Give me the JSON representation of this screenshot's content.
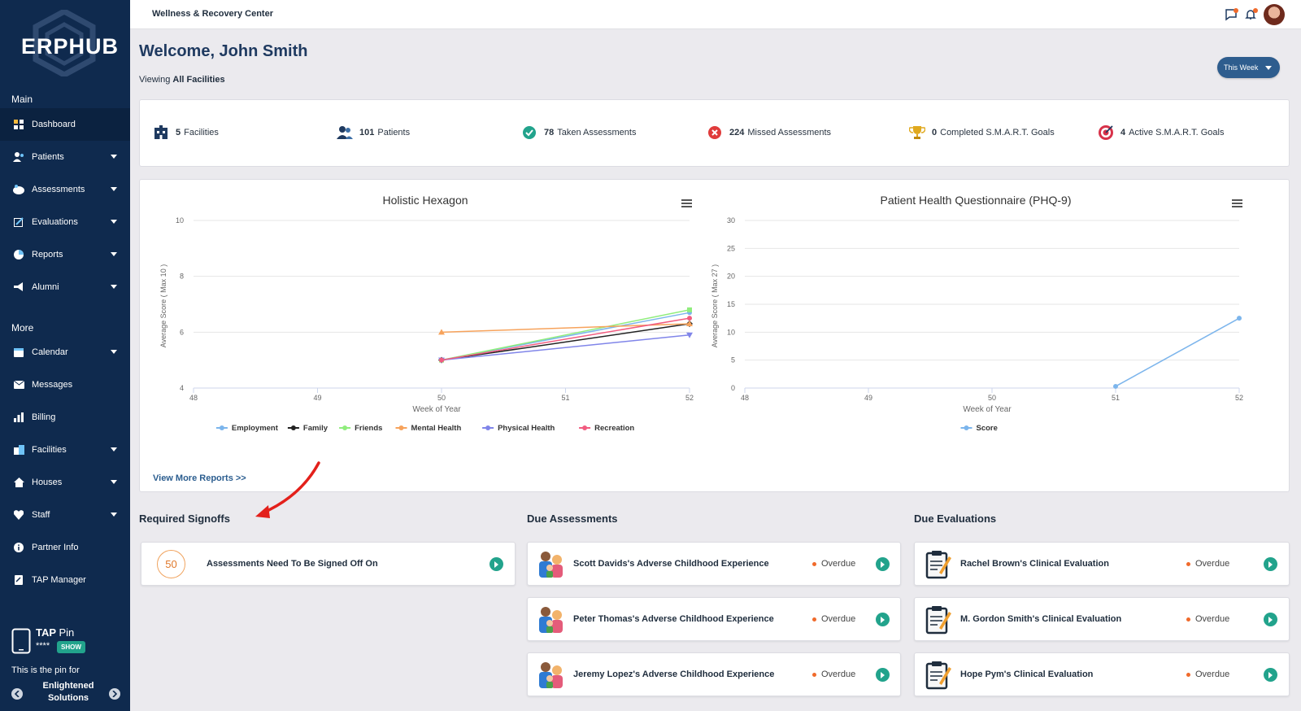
{
  "app": {
    "logo": "ERPHUB",
    "center_name": "Wellness & Recovery Center"
  },
  "sidebar": {
    "main_label": "Main",
    "more_label": "More",
    "items": [
      {
        "label": "Dashboard",
        "icon": "dashboard-icon",
        "caret": false
      },
      {
        "label": "Patients",
        "icon": "patients-icon",
        "caret": true
      },
      {
        "label": "Assessments",
        "icon": "assessments-icon",
        "caret": true
      },
      {
        "label": "Evaluations",
        "icon": "evaluations-icon",
        "caret": true
      },
      {
        "label": "Reports",
        "icon": "reports-icon",
        "caret": true
      },
      {
        "label": "Alumni",
        "icon": "alumni-icon",
        "caret": true
      },
      {
        "label": "Calendar",
        "icon": "calendar-icon",
        "caret": true
      },
      {
        "label": "Messages",
        "icon": "messages-icon",
        "caret": false
      },
      {
        "label": "Billing",
        "icon": "billing-icon",
        "caret": false
      },
      {
        "label": "Facilities",
        "icon": "facilities-icon",
        "caret": true
      },
      {
        "label": "Houses",
        "icon": "houses-icon",
        "caret": true
      },
      {
        "label": "Staff",
        "icon": "staff-icon",
        "caret": true
      },
      {
        "label": "Partner Info",
        "icon": "info-icon",
        "caret": false
      },
      {
        "label": "TAP Manager",
        "icon": "tap-manager-icon",
        "caret": false
      }
    ],
    "tap": {
      "title": "TAP",
      "pin_word": "Pin",
      "stars": "****",
      "show_label": "SHOW",
      "desc": "This is the pin for",
      "org": "Enlightened Solutions"
    }
  },
  "header": {
    "welcome": "Welcome, John Smith",
    "viewing_prefix": "Viewing",
    "viewing_value": "All Facilities",
    "range_label": "This Week"
  },
  "stats": [
    {
      "value": "5",
      "label": "Facilities",
      "icon": "hospital-icon"
    },
    {
      "value": "101",
      "label": "Patients",
      "icon": "users-icon"
    },
    {
      "value": "78",
      "label": "Taken Assessments",
      "icon": "check-circle-icon"
    },
    {
      "value": "224",
      "label": "Missed Assessments",
      "icon": "x-circle-icon"
    },
    {
      "value": "0",
      "label": "Completed S.M.A.R.T. Goals",
      "icon": "trophy-icon"
    },
    {
      "value": "4",
      "label": "Active S.M.A.R.T. Goals",
      "icon": "target-icon"
    }
  ],
  "chart_data": [
    {
      "type": "line",
      "title": "Holistic Hexagon",
      "xlabel": "Week of Year",
      "ylabel": "Average Score ( Max 10 )",
      "x_ticks": [
        48,
        49,
        50,
        51,
        52
      ],
      "y_ticks": [
        4,
        6,
        8,
        10
      ],
      "ylim": [
        4,
        10
      ],
      "xlim": [
        48,
        52
      ],
      "legend": "bottom",
      "series": [
        {
          "name": "Employment",
          "color": "#7cb5ec",
          "points": [
            [
              50,
              5.0
            ],
            [
              52,
              6.7
            ]
          ]
        },
        {
          "name": "Family",
          "color": "#222222",
          "points": [
            [
              50,
              5.0
            ],
            [
              52,
              6.3
            ]
          ]
        },
        {
          "name": "Friends",
          "color": "#90ed7d",
          "points": [
            [
              50,
              5.0
            ],
            [
              52,
              6.8
            ]
          ]
        },
        {
          "name": "Mental Health",
          "color": "#f7a35c",
          "points": [
            [
              50,
              6.0
            ],
            [
              52,
              6.3
            ]
          ]
        },
        {
          "name": "Physical Health",
          "color": "#8085e9",
          "points": [
            [
              50,
              5.0
            ],
            [
              52,
              5.9
            ]
          ]
        },
        {
          "name": "Recreation",
          "color": "#f15c80",
          "points": [
            [
              50,
              5.0
            ],
            [
              52,
              6.5
            ]
          ]
        }
      ]
    },
    {
      "type": "line",
      "title": "Patient Health Questionnaire (PHQ-9)",
      "xlabel": "Week of Year",
      "ylabel": "Average Score ( Max 27 )",
      "x_ticks": [
        48,
        49,
        50,
        51,
        52
      ],
      "y_ticks": [
        0,
        5,
        10,
        15,
        20,
        25,
        30
      ],
      "ylim": [
        0,
        30
      ],
      "xlim": [
        48,
        52
      ],
      "legend": "bottom",
      "series": [
        {
          "name": "Score",
          "color": "#7cb5ec",
          "points": [
            [
              51,
              0.3
            ],
            [
              52,
              12.5
            ]
          ]
        }
      ]
    }
  ],
  "reports_link": "View More Reports >>",
  "required_signoffs": {
    "title": "Required Signoffs",
    "count": "50",
    "text": "Assessments Need To Be Signed Off On"
  },
  "due_assessments": {
    "title": "Due Assessments",
    "items": [
      {
        "text": "Scott Davids's Adverse Childhood Experience",
        "status": "Overdue"
      },
      {
        "text": "Peter Thomas's Adverse Childhood Experience",
        "status": "Overdue"
      },
      {
        "text": "Jeremy Lopez's Adverse Childhood Experience",
        "status": "Overdue"
      }
    ]
  },
  "due_evaluations": {
    "title": "Due Evaluations",
    "items": [
      {
        "text": "Rachel Brown's Clinical Evaluation",
        "status": "Overdue"
      },
      {
        "text": "M. Gordon Smith's Clinical Evaluation",
        "status": "Overdue"
      },
      {
        "text": "Hope Pym's Clinical Evaluation",
        "status": "Overdue"
      }
    ]
  },
  "colors": {
    "sidebar": "#0f2a4e",
    "accent": "#2e5d8e",
    "go": "#22a38c",
    "overdue": "#f06a2b"
  }
}
